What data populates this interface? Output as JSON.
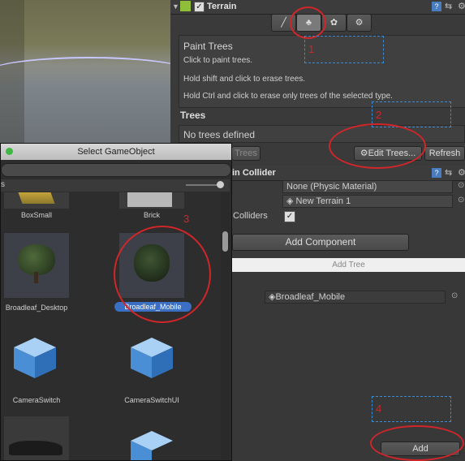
{
  "component": {
    "name": "Terrain",
    "checked": true
  },
  "tool_tabs": [
    {
      "icon": "brush-icon"
    },
    {
      "icon": "tree-icon"
    },
    {
      "icon": "grass-icon"
    },
    {
      "icon": "gear-icon"
    }
  ],
  "paint": {
    "title": "Paint Trees",
    "line1": "Click to paint trees.",
    "line2": "Hold shift and click to erase trees.",
    "line3": "Hold Ctrl and click to erase only trees of the selected type."
  },
  "trees": {
    "header": "Trees",
    "empty": "No trees defined",
    "left_btn": "Trees",
    "edit_btn": "Edit Trees...",
    "refresh_btn": "Refresh"
  },
  "collider": {
    "header": "in Collider",
    "material_value": "None (Physic Material)",
    "terrain_value": "New Terrain 1",
    "colliders_label": "Colliders",
    "add_component": "Add Component"
  },
  "add_tree": {
    "title": "Add Tree",
    "prefab_value": "Broadleaf_Mobile",
    "add_btn": "Add"
  },
  "dialog": {
    "title": "Select GameObject",
    "partial_label": "s",
    "items": [
      {
        "label": "BoxSmall"
      },
      {
        "label": "Brick"
      },
      {
        "label": "Broadleaf_Desktop"
      },
      {
        "label": "Broadleaf_Mobile"
      },
      {
        "label": "CameraSwitch"
      },
      {
        "label": "CameraSwitchUI"
      }
    ]
  },
  "annotations": [
    "1",
    "2",
    "3",
    "4"
  ],
  "colors": {
    "accent": "#3a6fc4",
    "annotation": "#d0262a"
  }
}
